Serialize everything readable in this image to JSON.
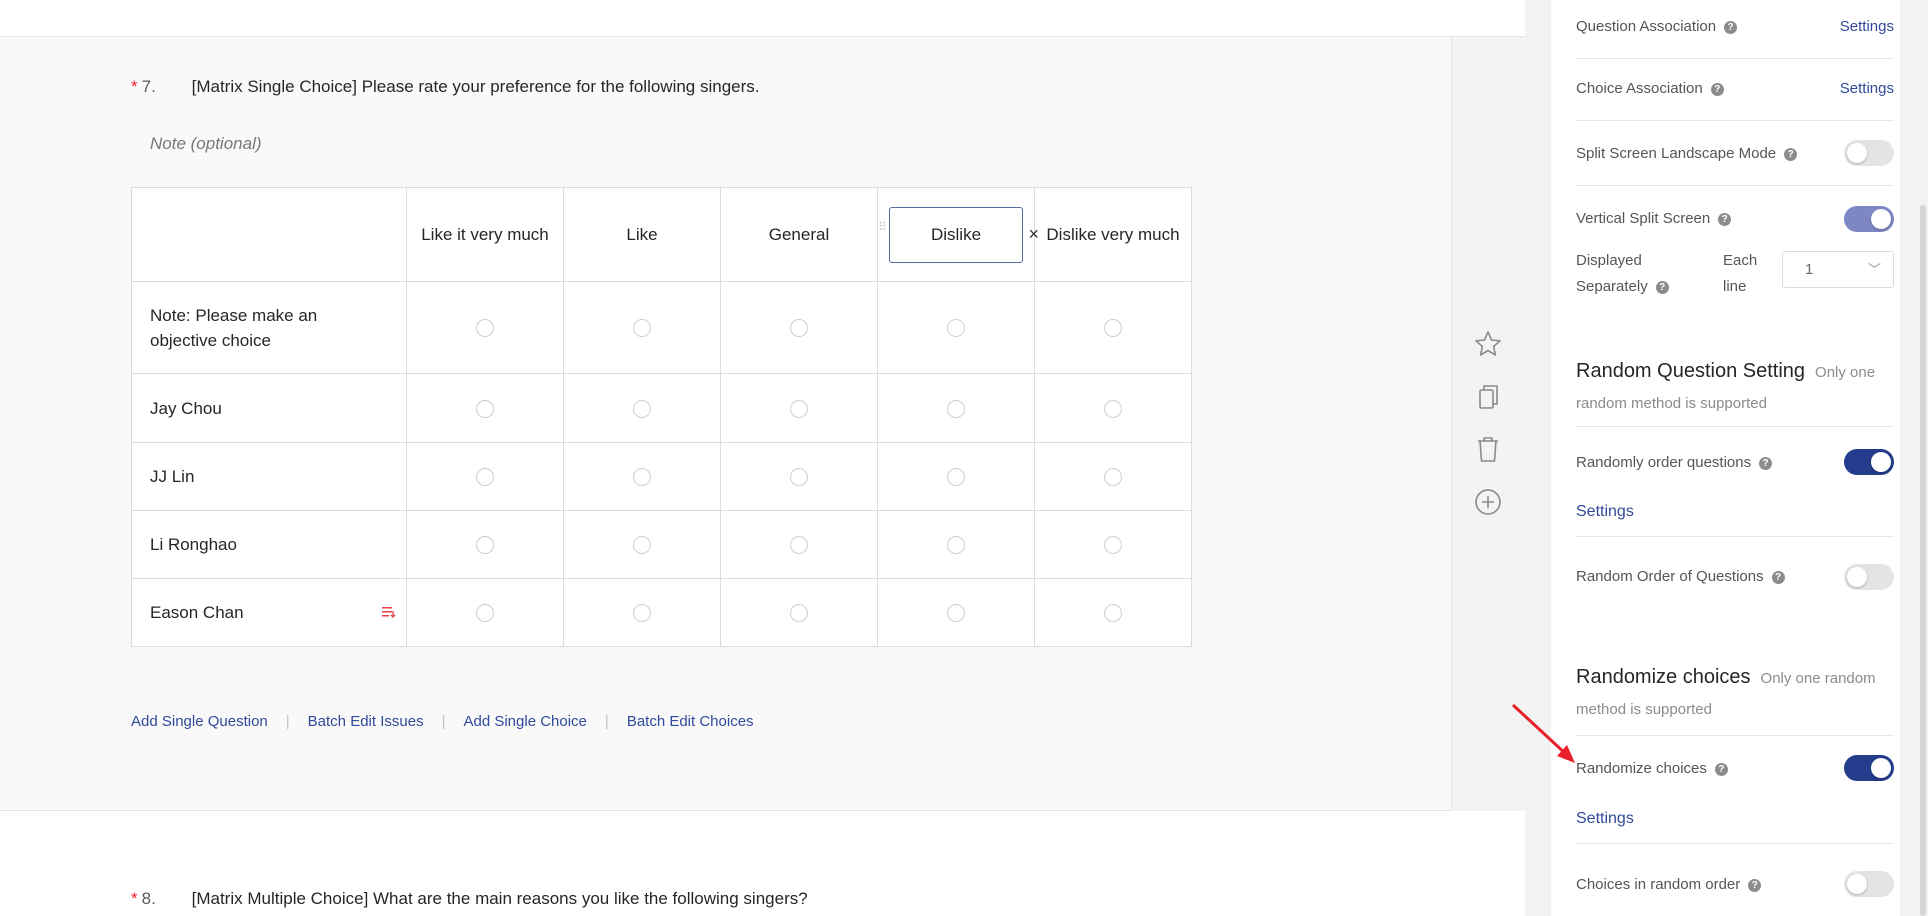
{
  "question7": {
    "required_mark": "*",
    "number": "7.",
    "title": "[Matrix Single Choice] Please rate your preference for the following singers.",
    "note_placeholder": "Note (optional)",
    "columns": [
      "Like it very much",
      "Like",
      "General",
      "Dislike",
      "Dislike very much"
    ],
    "rows": [
      "Note: Please make an objective choice",
      "Jay Chou",
      "JJ Lin",
      "Li Ronghao",
      "Eason Chan"
    ],
    "actions": [
      "Add Single Question",
      "Batch Edit Issues",
      "Add Single Choice",
      "Batch Edit Choices"
    ],
    "action_separator": "|"
  },
  "question8": {
    "required_mark": "*",
    "number": "8.",
    "title": "[Matrix Multiple Choice] What are the main reasons you like the following singers?"
  },
  "toolbar_icons": [
    "star-icon",
    "copy-icon",
    "trash-icon",
    "add-circle-icon"
  ],
  "panel": {
    "help_glyph": "?",
    "question_association": {
      "label": "Question Association",
      "link": "Settings"
    },
    "choice_association": {
      "label": "Choice Association",
      "link": "Settings"
    },
    "split_landscape": {
      "label": "Split Screen Landscape Mode",
      "on": false
    },
    "vertical_split": {
      "label": "Vertical Split Screen",
      "on": true
    },
    "displayed_separately": {
      "label_line1": "Displayed",
      "label_line2": "Separately",
      "each_line1": "Each",
      "each_line2": "line",
      "value": "1"
    },
    "random_question_setting": {
      "title": "Random Question Setting",
      "subtitle_line1": "Only one",
      "subtitle_line2": "random method is supported"
    },
    "randomly_order_questions": {
      "label": "Randomly order questions",
      "on": true,
      "link": "Settings"
    },
    "random_order_of_questions": {
      "label": "Random Order of Questions",
      "on": false
    },
    "randomize_choices_section": {
      "title": "Randomize choices",
      "subtitle_line1": "Only one random",
      "subtitle_line2": "method is supported"
    },
    "randomize_choices": {
      "label": "Randomize choices",
      "on": true,
      "link": "Settings"
    },
    "choices_in_random_order": {
      "label": "Choices in random order",
      "on": false
    }
  },
  "colors": {
    "accent": "#253c8d",
    "link": "#2f4a9a",
    "required": "#f5222d",
    "annotation_arrow": "#e8202a"
  }
}
